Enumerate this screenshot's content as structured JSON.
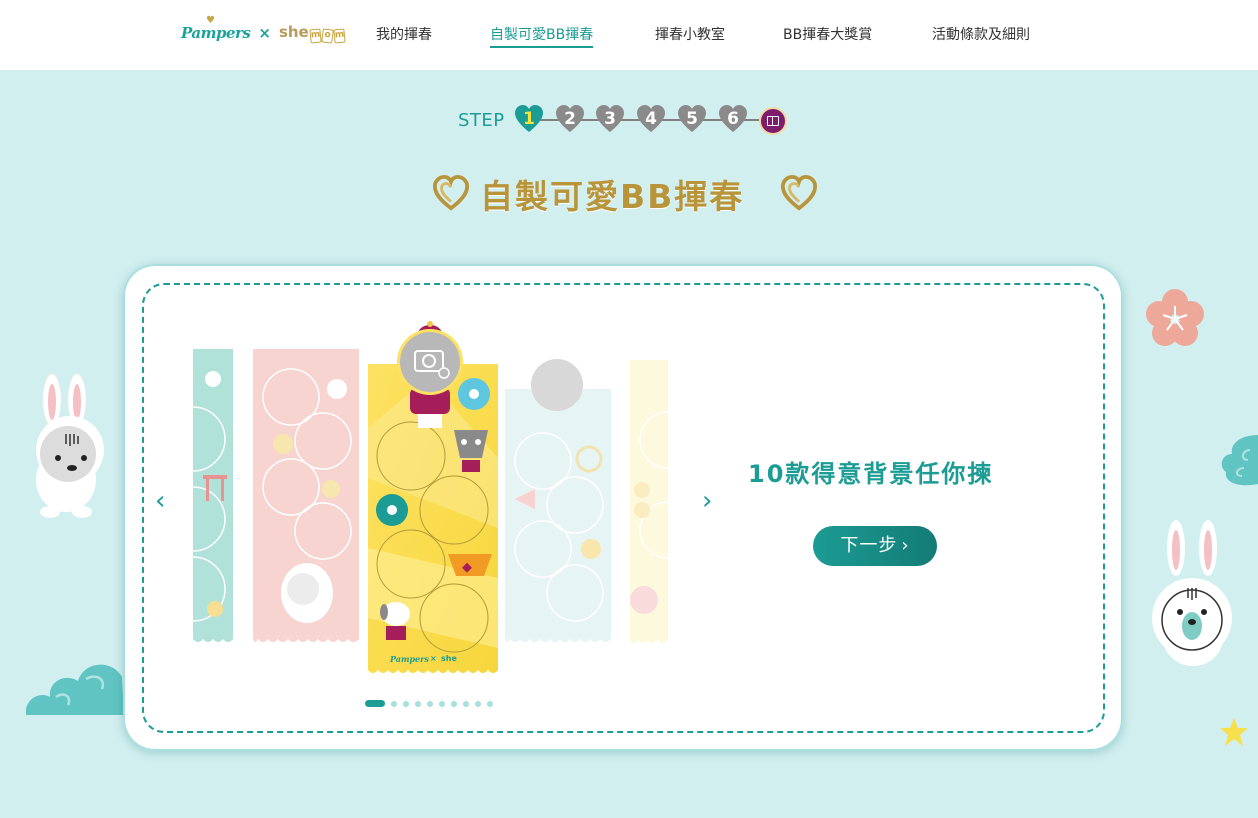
{
  "header": {
    "logo": {
      "brand": "Pampers",
      "separator": "×",
      "partner_she": "she",
      "partner_mom": [
        "m",
        "o",
        "m"
      ]
    },
    "nav": [
      {
        "label": "我的揮春",
        "active": false
      },
      {
        "label": "自製可愛BB揮春",
        "active": true
      },
      {
        "label": "揮春小教室",
        "active": false
      },
      {
        "label": "BB揮春大獎賞",
        "active": false
      },
      {
        "label": "活動條款及細則",
        "active": false
      }
    ]
  },
  "steps": {
    "label": "STEP",
    "items": [
      "1",
      "2",
      "3",
      "4",
      "5",
      "6"
    ],
    "current": 1,
    "final_icon": "book-icon"
  },
  "title": "自製可愛BB揮春",
  "carousel": {
    "tagline": "10款得意背景任你揀",
    "next_label": "下一步",
    "dot_count": 10,
    "active_index": 0,
    "strip_logo_brand": "Pampers",
    "strip_logo_sep": "×",
    "strip_logo_partner": "she"
  },
  "icons": {
    "prev": "chevron-left-icon",
    "next": "chevron-right-icon",
    "camera": "camera-add-icon"
  },
  "colors": {
    "teal": "#1b9c94",
    "gold": "#b8953a",
    "background": "#d2eff0",
    "final_step": "#7e1d6b",
    "strip_yellow": "#fbe25a"
  }
}
